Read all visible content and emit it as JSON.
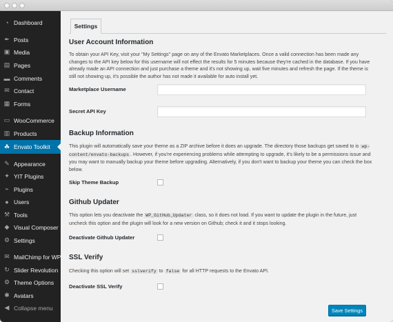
{
  "sidebar": {
    "items": [
      {
        "label": "Dashboard",
        "icon": "dashboard-icon",
        "glyph": "◔"
      },
      {
        "label": "Posts",
        "icon": "pin-icon",
        "glyph": "✒"
      },
      {
        "label": "Media",
        "icon": "media-icon",
        "glyph": "▣"
      },
      {
        "label": "Pages",
        "icon": "pages-icon",
        "glyph": "▤"
      },
      {
        "label": "Comments",
        "icon": "comments-icon",
        "glyph": "▬"
      },
      {
        "label": "Contact",
        "icon": "mail-icon",
        "glyph": "✉"
      },
      {
        "label": "Forms",
        "icon": "forms-icon",
        "glyph": "▦"
      },
      {
        "label": "WooCommerce",
        "icon": "woocommerce-icon",
        "glyph": "▭"
      },
      {
        "label": "Products",
        "icon": "products-icon",
        "glyph": "▥"
      },
      {
        "label": "Envato Toolkit",
        "icon": "envato-leaf-icon",
        "glyph": "☘"
      },
      {
        "label": "Appearance",
        "icon": "appearance-brush-icon",
        "glyph": "✎"
      },
      {
        "label": "YIT Plugins",
        "icon": "yit-icon",
        "glyph": "✦"
      },
      {
        "label": "Plugins",
        "icon": "plugins-icon",
        "glyph": "⌁"
      },
      {
        "label": "Users",
        "icon": "users-icon",
        "glyph": "●"
      },
      {
        "label": "Tools",
        "icon": "tools-icon",
        "glyph": "⚒"
      },
      {
        "label": "Visual Composer",
        "icon": "visual-composer-icon",
        "glyph": "◆"
      },
      {
        "label": "Settings",
        "icon": "settings-icon",
        "glyph": "⚙"
      },
      {
        "label": "MailChimp for WP",
        "icon": "mailchimp-icon",
        "glyph": "✉"
      },
      {
        "label": "Slider Revolution",
        "icon": "slider-revolution-icon",
        "glyph": "↻"
      },
      {
        "label": "Theme Options",
        "icon": "theme-options-icon",
        "glyph": "⚙"
      },
      {
        "label": "Avatars",
        "icon": "avatars-icon",
        "glyph": "✱"
      }
    ],
    "collapse": {
      "label": "Collapse menu",
      "icon": "collapse-arrow-icon",
      "glyph": "◀"
    }
  },
  "tab": {
    "label": "Settings"
  },
  "account": {
    "heading": "User Account Information",
    "description": "To obtain your API Key, visit your \"My Settings\" page on any of the Envato Marketplaces. Once a valid connection has been made any changes to the API key below for this username will not effect the results for 5 minutes because they're cached in the database. If you have already made an API connection and just purchase a theme and it's not showing up, wait five minutes and refresh the page. If the theme is still not showing up, it's possible the author has not made it available for auto install yet.",
    "username_label": "Marketplace Username",
    "username_value": "",
    "apikey_label": "Secret API Key",
    "apikey_value": ""
  },
  "backup": {
    "heading": "Backup Information",
    "desc_part1": "This plugin will automatically save your theme as a ZIP archive before it does an upgrade. The directory those backups get saved to is ",
    "desc_code": "wp-content/envato-backups",
    "desc_part2": ". However, if you're experiencing problems while attempting to upgrade, it's likely to be a permissions issue and you may want to manually backup your theme before upgrading. Alternatively, if you don't want to backup your theme you can check the box below.",
    "skip_label": "Skip Theme Backup"
  },
  "github": {
    "heading": "Github Updater",
    "desc_part1": "This option lets you deactivate the ",
    "desc_code": "WP_GitHub_Updater",
    "desc_part2": " class, so it does not load. If you want to update the plugin in the future, just uncheck this option and the plugin will look for a new version on Github; check it and it stops looking.",
    "deactivate_label": "Deactivate Github Updater"
  },
  "ssl": {
    "heading": "SSL Verify",
    "desc_part1": "Checking this option will set ",
    "desc_code1": "sslverify",
    "desc_part2": " to ",
    "desc_code2": "false",
    "desc_part3": " for all HTTP requests to the Envato API.",
    "deactivate_label": "Deactivate SSL Verify"
  },
  "save_button": {
    "label": "Save Settings"
  },
  "colors": {
    "sidebar_bg": "#222222",
    "active": "#0073aa",
    "button": "#0085ba",
    "content_bg": "#f1f1f1"
  }
}
